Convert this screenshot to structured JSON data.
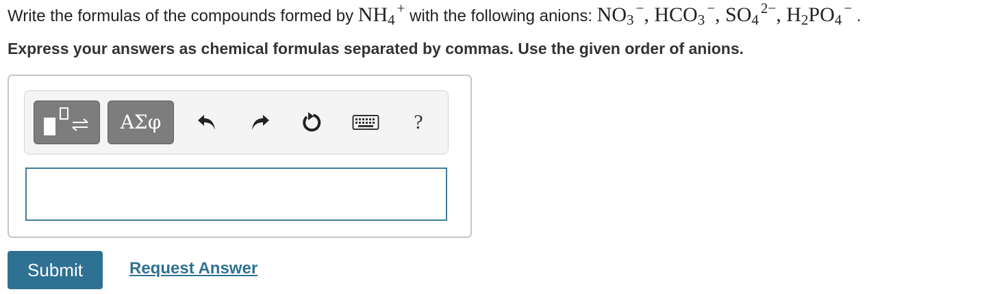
{
  "question": {
    "intro": "Write the formulas of the compounds formed by ",
    "cation": {
      "base": "NH",
      "sub": "4",
      "charge": "+"
    },
    "middle": " with the following anions: ",
    "anions": [
      {
        "base": "NO",
        "sub": "3",
        "charge": "−"
      },
      {
        "base": "HCO",
        "sub": "3",
        "charge": "−"
      },
      {
        "base": "SO",
        "sub": "4",
        "charge": "2−"
      },
      {
        "base": "H",
        "sub1": "2",
        "base2": "PO",
        "sub": "4",
        "charge": "−"
      }
    ],
    "separator": ", ",
    "end": "."
  },
  "instruction": "Express your answers as chemical formulas separated by commas. Use the given order of anions.",
  "toolbar": {
    "template_icon": "template-fraction-icon",
    "greek_label": "ΑΣφ",
    "undo_icon": "undo-icon",
    "redo_icon": "redo-icon",
    "reset_icon": "reset-icon",
    "keyboard_icon": "keyboard-icon",
    "help_label": "?"
  },
  "answer_input": {
    "value": ""
  },
  "actions": {
    "submit_label": "Submit",
    "request_label": "Request Answer"
  },
  "colors": {
    "accent": "#2f7193",
    "input_border": "#3f7c99",
    "tool_button": "#7d7d7d"
  }
}
